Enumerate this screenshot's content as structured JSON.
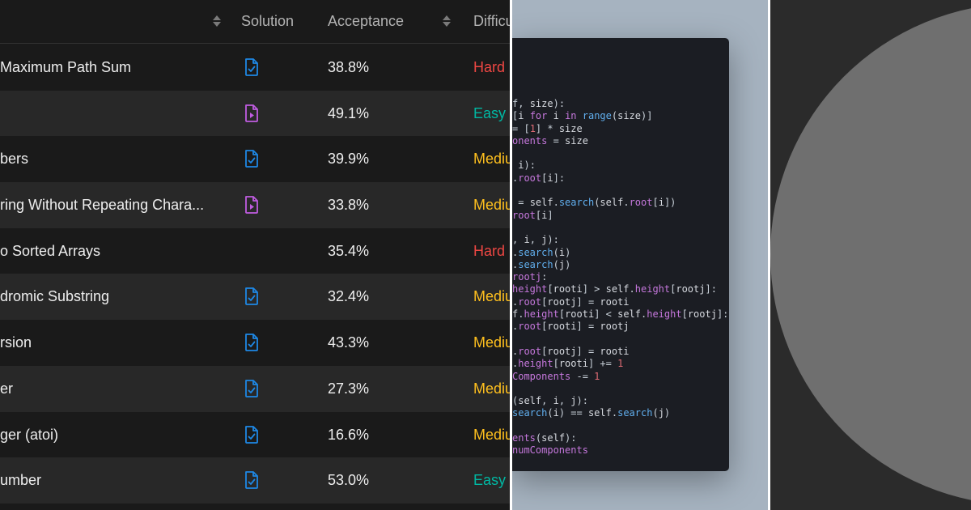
{
  "table": {
    "headers": {
      "solution": "Solution",
      "acceptance": "Acceptance",
      "difficulty": "Difficu"
    },
    "rows": [
      {
        "title": "Maximum Path Sum",
        "solution": "article",
        "acceptance": "38.8%",
        "difficulty": "Hard",
        "level": "hard"
      },
      {
        "title": "",
        "solution": "video",
        "acceptance": "49.1%",
        "difficulty": "Easy",
        "level": "easy"
      },
      {
        "title": "bers",
        "solution": "article",
        "acceptance": "39.9%",
        "difficulty": "Mediu",
        "level": "med"
      },
      {
        "title": "ring Without Repeating Chara...",
        "solution": "video",
        "acceptance": "33.8%",
        "difficulty": "Mediu",
        "level": "med"
      },
      {
        "title": "o Sorted Arrays",
        "solution": "",
        "acceptance": "35.4%",
        "difficulty": "Hard",
        "level": "hard"
      },
      {
        "title": "dromic Substring",
        "solution": "article",
        "acceptance": "32.4%",
        "difficulty": "Mediu",
        "level": "med"
      },
      {
        "title": "rsion",
        "solution": "article",
        "acceptance": "43.3%",
        "difficulty": "Mediu",
        "level": "med"
      },
      {
        "title": "er",
        "solution": "article",
        "acceptance": "27.3%",
        "difficulty": "Mediu",
        "level": "med"
      },
      {
        "title": "ger (atoi)",
        "solution": "article",
        "acceptance": "16.6%",
        "difficulty": "Mediu",
        "level": "med"
      },
      {
        "title": "umber",
        "solution": "article",
        "acceptance": "53.0%",
        "difficulty": "Easy",
        "level": "easy"
      }
    ]
  },
  "colors": {
    "hard": "#ef4743",
    "easy": "#00b8a3",
    "medium": "#ffc01e",
    "article_icon": "#1e88e5",
    "video_icon": "#c05ce0"
  },
  "code": {
    "lines": [
      [
        [
          "op",
          "f, "
        ],
        [
          "id",
          "size"
        ],
        [
          "op",
          "):"
        ]
      ],
      [
        [
          "op",
          "["
        ],
        [
          "id",
          "i "
        ],
        [
          "kw",
          "for"
        ],
        [
          "id",
          " i "
        ],
        [
          "kw",
          "in"
        ],
        [
          "op",
          " "
        ],
        [
          "fn",
          "range"
        ],
        [
          "op",
          "("
        ],
        [
          "id",
          "size"
        ],
        [
          "op",
          ")]"
        ]
      ],
      [
        [
          "op",
          "= ["
        ],
        [
          "num",
          "1"
        ],
        [
          "op",
          "] * "
        ],
        [
          "id",
          "size"
        ]
      ],
      [
        [
          "pl",
          "onents"
        ],
        [
          "op",
          " = "
        ],
        [
          "id",
          "size"
        ]
      ],
      [
        [
          "op",
          ""
        ]
      ],
      [
        [
          "op",
          " "
        ],
        [
          "id",
          "i"
        ],
        [
          "op",
          "):"
        ]
      ],
      [
        [
          "op",
          "."
        ],
        [
          "pl",
          "root"
        ],
        [
          "op",
          "["
        ],
        [
          "id",
          "i"
        ],
        [
          "op",
          "]:"
        ]
      ],
      [
        [
          "op",
          ""
        ]
      ],
      [
        [
          "op",
          " = "
        ],
        [
          "id",
          "self"
        ],
        [
          "op",
          "."
        ],
        [
          "fn",
          "search"
        ],
        [
          "op",
          "("
        ],
        [
          "id",
          "self"
        ],
        [
          "op",
          "."
        ],
        [
          "pl",
          "root"
        ],
        [
          "op",
          "["
        ],
        [
          "id",
          "i"
        ],
        [
          "op",
          "])"
        ]
      ],
      [
        [
          "pl",
          "root"
        ],
        [
          "op",
          "["
        ],
        [
          "id",
          "i"
        ],
        [
          "op",
          "]"
        ]
      ],
      [
        [
          "op",
          ""
        ]
      ],
      [
        [
          "op",
          ", "
        ],
        [
          "id",
          "i"
        ],
        [
          "op",
          ", "
        ],
        [
          "id",
          "j"
        ],
        [
          "op",
          "):"
        ]
      ],
      [
        [
          "op",
          "."
        ],
        [
          "fn",
          "search"
        ],
        [
          "op",
          "("
        ],
        [
          "id",
          "i"
        ],
        [
          "op",
          ")"
        ]
      ],
      [
        [
          "op",
          "."
        ],
        [
          "fn",
          "search"
        ],
        [
          "op",
          "("
        ],
        [
          "id",
          "j"
        ],
        [
          "op",
          ")"
        ]
      ],
      [
        [
          "pl",
          "rootj"
        ],
        [
          "op",
          ":"
        ]
      ],
      [
        [
          "pl",
          "height"
        ],
        [
          "op",
          "["
        ],
        [
          "id",
          "rooti"
        ],
        [
          "op",
          "] > "
        ],
        [
          "id",
          "self"
        ],
        [
          "op",
          "."
        ],
        [
          "pl",
          "height"
        ],
        [
          "op",
          "["
        ],
        [
          "id",
          "rootj"
        ],
        [
          "op",
          "]:"
        ]
      ],
      [
        [
          "op",
          "."
        ],
        [
          "pl",
          "root"
        ],
        [
          "op",
          "["
        ],
        [
          "id",
          "rootj"
        ],
        [
          "op",
          "] = "
        ],
        [
          "id",
          "rooti"
        ]
      ],
      [
        [
          "id",
          "f"
        ],
        [
          "op",
          "."
        ],
        [
          "pl",
          "height"
        ],
        [
          "op",
          "["
        ],
        [
          "id",
          "rooti"
        ],
        [
          "op",
          "] < "
        ],
        [
          "id",
          "self"
        ],
        [
          "op",
          "."
        ],
        [
          "pl",
          "height"
        ],
        [
          "op",
          "["
        ],
        [
          "id",
          "rootj"
        ],
        [
          "op",
          "]:"
        ]
      ],
      [
        [
          "op",
          "."
        ],
        [
          "pl",
          "root"
        ],
        [
          "op",
          "["
        ],
        [
          "id",
          "rooti"
        ],
        [
          "op",
          "] = "
        ],
        [
          "id",
          "rootj"
        ]
      ],
      [
        [
          "op",
          ""
        ]
      ],
      [
        [
          "op",
          "."
        ],
        [
          "pl",
          "root"
        ],
        [
          "op",
          "["
        ],
        [
          "id",
          "rootj"
        ],
        [
          "op",
          "] = "
        ],
        [
          "id",
          "rooti"
        ]
      ],
      [
        [
          "op",
          "."
        ],
        [
          "pl",
          "height"
        ],
        [
          "op",
          "["
        ],
        [
          "id",
          "rooti"
        ],
        [
          "op",
          "] += "
        ],
        [
          "num",
          "1"
        ]
      ],
      [
        [
          "pl",
          "Components"
        ],
        [
          "op",
          " -= "
        ],
        [
          "num",
          "1"
        ]
      ],
      [
        [
          "op",
          ""
        ]
      ],
      [
        [
          "op",
          "("
        ],
        [
          "id",
          "self"
        ],
        [
          "op",
          ", "
        ],
        [
          "id",
          "i"
        ],
        [
          "op",
          ", "
        ],
        [
          "id",
          "j"
        ],
        [
          "op",
          "):"
        ]
      ],
      [
        [
          "fn",
          "search"
        ],
        [
          "op",
          "("
        ],
        [
          "id",
          "i"
        ],
        [
          "op",
          ") == "
        ],
        [
          "id",
          "self"
        ],
        [
          "op",
          "."
        ],
        [
          "fn",
          "search"
        ],
        [
          "op",
          "("
        ],
        [
          "id",
          "j"
        ],
        [
          "op",
          ")"
        ]
      ],
      [
        [
          "op",
          ""
        ]
      ],
      [
        [
          "pl",
          "ents"
        ],
        [
          "op",
          "("
        ],
        [
          "id",
          "self"
        ],
        [
          "op",
          "):"
        ]
      ],
      [
        [
          "pl",
          "numComponents"
        ]
      ]
    ]
  }
}
